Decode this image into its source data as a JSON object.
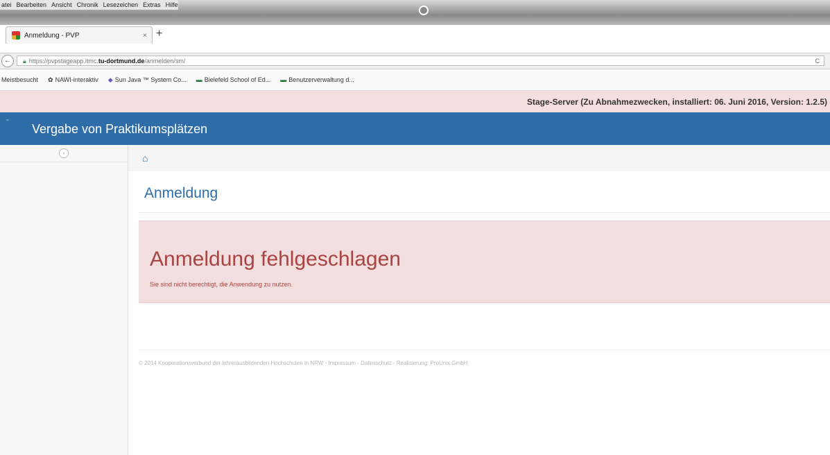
{
  "browser": {
    "menu": [
      "atei",
      "Bearbeiten",
      "Ansicht",
      "Chronik",
      "Lesezeichen",
      "Extras",
      "Hilfe"
    ],
    "tab": {
      "title": "Anmeldung - PVP",
      "close": "×"
    },
    "new_tab": "+",
    "url": {
      "prefix": "https://pvpstageapp.itmc.",
      "domain": "tu-dortmund.de",
      "path": "/anmelden/sm/",
      "back": "←",
      "reload": "C"
    },
    "bookmarks": [
      {
        "icon": "",
        "label": "Meistbesucht"
      },
      {
        "icon": "✿",
        "label": "NAWI-interaktiv"
      },
      {
        "icon": "◆",
        "label": "Sun Java ™ System Co..."
      },
      {
        "icon": "▬",
        "label": "Bielefeld School of Ed..."
      },
      {
        "icon": "▬",
        "label": "Benutzerverwaltung d..."
      }
    ]
  },
  "stage": {
    "text": "Stage-Server (Zu Abnahmezwecken, installiert: 06. Juni 2016, Version: 1.2.5)"
  },
  "header": {
    "title": "Vergabe von Praktikumsplätzen"
  },
  "sidebar": {
    "toggle": "‹"
  },
  "breadcrumb": {
    "home": "⌂"
  },
  "main": {
    "title": "Anmeldung",
    "alert": {
      "heading": "Anmeldung fehlgeschlagen",
      "text": "Sie sind nicht berechtigt, die Anwendung zu nutzen."
    }
  },
  "footer": {
    "text": "© 2014 Kooperationsverbund der lehrerausbildenden Hochschulen in NRW - Impressum - Datenschutz - Realisierung: ProUnix GmbH"
  }
}
